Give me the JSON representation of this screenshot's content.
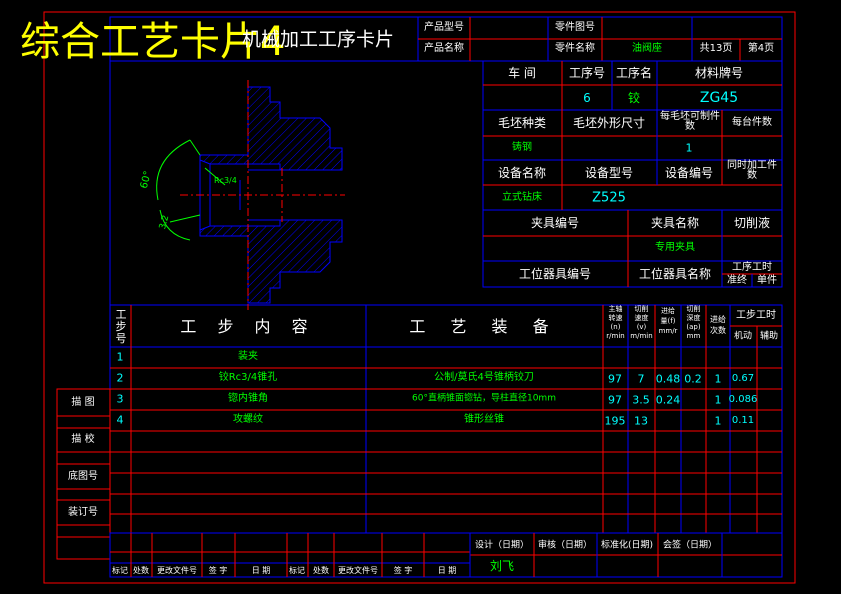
{
  "overlay_title": "综合工艺卡片4",
  "header": {
    "card_title": "机械加工工序卡片",
    "product_model_label": "产品型号",
    "product_name_label": "产品名称",
    "part_no_label": "零件图号",
    "part_name_label": "零件名称",
    "part_name_value": "油阀座",
    "total_pages": "共13页",
    "page_no": "第4页"
  },
  "info": {
    "workshop_label": "车 间",
    "op_no_label": "工序号",
    "op_name_label": "工序名",
    "material_label": "材料牌号",
    "op_no_value": "6",
    "op_name_value": "铰",
    "material_value": "ZG45",
    "blank_type_label": "毛坯种类",
    "blank_shape_label": "毛坯外形尺寸",
    "pieces_per_blank_label": "每毛坯可制件数",
    "pieces_per_unit_label": "每台件数",
    "blank_type_value": "铸钢",
    "pieces_per_blank_value": "1",
    "equip_name_label": "设备名称",
    "equip_model_label": "设备型号",
    "equip_no_label": "设备编号",
    "simul_parts_label": "同时加工件数",
    "equip_name_value": "立式钻床",
    "equip_model_value": "Z525",
    "fixture_no_label": "夹具编号",
    "fixture_name_label": "夹具名称",
    "coolant_label": "切削液",
    "fixture_name_value": "专用夹具",
    "station_tool_no_label": "工位器具编号",
    "station_tool_name_label": "工位器具名称",
    "op_time_label": "工序工时",
    "prep_label": "准终",
    "unit_label": "单件"
  },
  "drawing": {
    "angle_label": "60°",
    "thread_label": "Rc3/4",
    "roughness_label": "3.2"
  },
  "steps_table": {
    "col_step_no": "工步号",
    "col_content": "工 步 内 容",
    "col_equipment": "工 艺 装 备",
    "col_speed": [
      "主轴",
      "转速",
      "(n)",
      "r/min"
    ],
    "col_cut_speed": [
      "切削",
      "速度",
      "(v)",
      "m/min"
    ],
    "col_feed": [
      "进给",
      "量(f)",
      "mm/r"
    ],
    "col_depth": [
      "切削",
      "深度",
      "(ap)",
      "mm"
    ],
    "col_passes": [
      "进给",
      "次数"
    ],
    "col_step_time": "工步工时",
    "col_machine": "机动",
    "col_aux": "辅助",
    "rows": [
      {
        "no": "1",
        "content": "装夹",
        "equipment": "",
        "n": "",
        "v": "",
        "f": "",
        "ap": "",
        "passes": "",
        "machine": ""
      },
      {
        "no": "2",
        "content": "铰Rc3/4锥孔",
        "equipment": "公制/莫氏4号锥柄铰刀",
        "n": "97",
        "v": "7",
        "f": "0.48",
        "ap": "0.2",
        "passes": "1",
        "machine": "0.67"
      },
      {
        "no": "3",
        "content": "锪内锥角",
        "equipment": "60°直柄锥面锪钻，导柱直径10mm",
        "n": "97",
        "v": "3.5",
        "f": "0.24",
        "ap": "",
        "passes": "1",
        "machine": "0.086"
      },
      {
        "no": "4",
        "content": "攻螺纹",
        "equipment": "锥形丝锥",
        "n": "195",
        "v": "13",
        "f": "",
        "ap": "",
        "passes": "1",
        "machine": "0.11"
      }
    ]
  },
  "side_labels": [
    "描 图",
    "描 校",
    "底图号",
    "装订号"
  ],
  "footer": {
    "design": "设计（日期）",
    "review": "审核（日期）",
    "standard": "标准化(日期)",
    "countersign": "会签（日期）",
    "designer": "刘飞",
    "bottom_labels": [
      "标记",
      "处数",
      "更改文件号",
      "签 字",
      "日 期",
      "标记",
      "处数",
      "更改文件号",
      "签 字",
      "日 期"
    ]
  }
}
